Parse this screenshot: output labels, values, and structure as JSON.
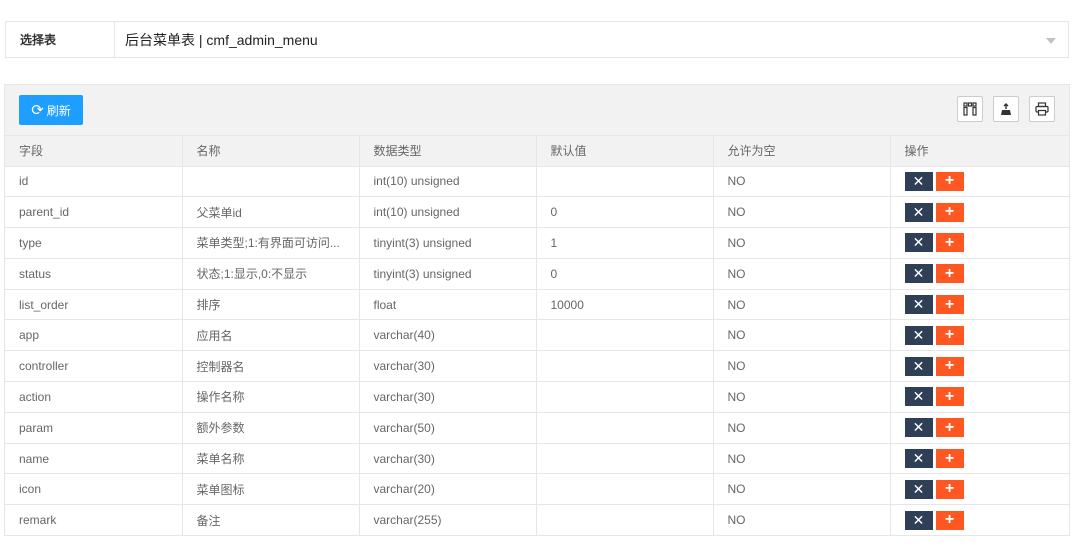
{
  "selector": {
    "label": "选择表",
    "value": "后台菜单表 | cmf_admin_menu"
  },
  "toolbar": {
    "refresh_label": "刷新",
    "refresh_icon": "refresh-icon",
    "tools": [
      "columns-icon",
      "export-icon",
      "print-icon"
    ]
  },
  "colors": {
    "primary": "#1e9fff",
    "delete_button": "#2f4056",
    "add_button": "#ff5722"
  },
  "table": {
    "headers": [
      "字段",
      "名称",
      "数据类型",
      "默认值",
      "允许为空",
      "操作"
    ],
    "rows": [
      [
        "id",
        "",
        "int(10) unsigned",
        "",
        "NO"
      ],
      [
        "parent_id",
        "父菜单id",
        "int(10) unsigned",
        "0",
        "NO"
      ],
      [
        "type",
        "菜单类型;1:有界面可访问...",
        "tinyint(3) unsigned",
        "1",
        "NO"
      ],
      [
        "status",
        "状态;1:显示,0:不显示",
        "tinyint(3) unsigned",
        "0",
        "NO"
      ],
      [
        "list_order",
        "排序",
        "float",
        "10000",
        "NO"
      ],
      [
        "app",
        "应用名",
        "varchar(40)",
        "",
        "NO"
      ],
      [
        "controller",
        "控制器名",
        "varchar(30)",
        "",
        "NO"
      ],
      [
        "action",
        "操作名称",
        "varchar(30)",
        "",
        "NO"
      ],
      [
        "param",
        "额外参数",
        "varchar(50)",
        "",
        "NO"
      ],
      [
        "name",
        "菜单名称",
        "varchar(30)",
        "",
        "NO"
      ],
      [
        "icon",
        "菜单图标",
        "varchar(20)",
        "",
        "NO"
      ],
      [
        "remark",
        "备注",
        "varchar(255)",
        "",
        "NO"
      ]
    ],
    "op_delete_symbol": "✕",
    "op_add_symbol": "+"
  }
}
